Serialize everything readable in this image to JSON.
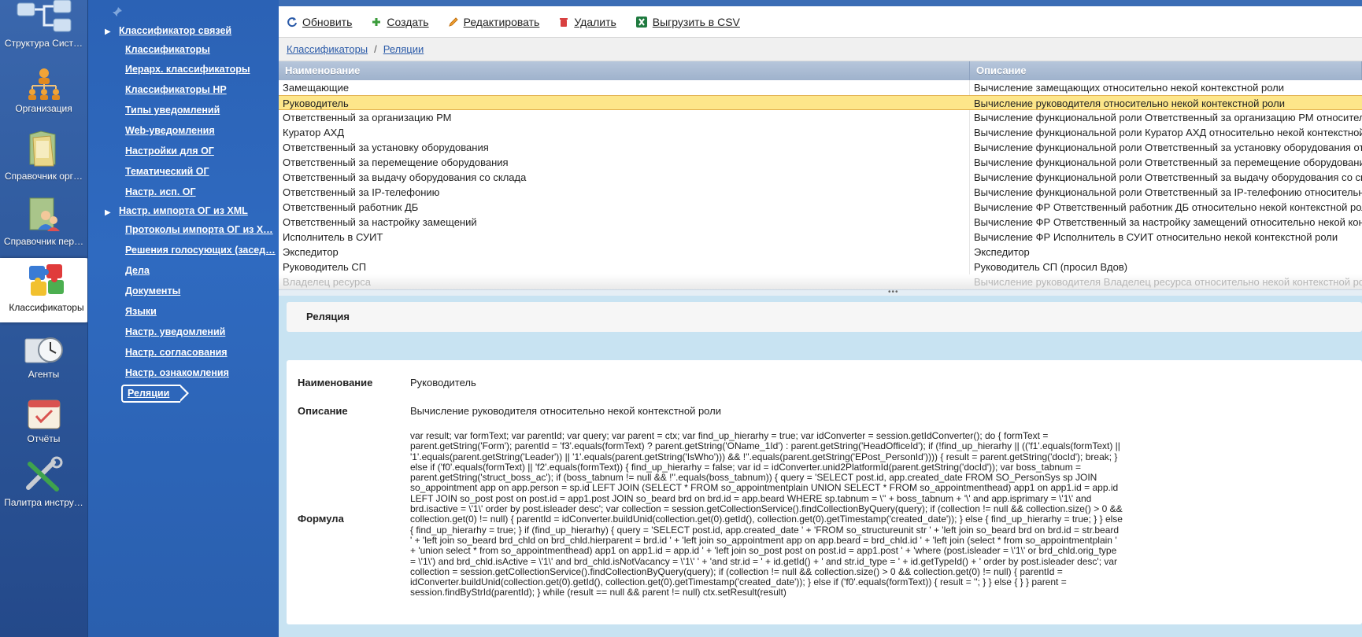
{
  "rail": {
    "items": [
      {
        "label": "Структура Сист…",
        "icon": "structure-icon"
      },
      {
        "label": "Организация",
        "icon": "organization-icon"
      },
      {
        "label": "Справочник орг…",
        "icon": "folder-icon"
      },
      {
        "label": "Справочник пер…",
        "icon": "people-directory-icon"
      },
      {
        "label": "Классификаторы",
        "icon": "puzzle-icon"
      },
      {
        "label": "Агенты",
        "icon": "clock-icon"
      },
      {
        "label": "Отчёты",
        "icon": "calendar-check-icon"
      },
      {
        "label": "Палитра инстру…",
        "icon": "tools-icon"
      }
    ]
  },
  "nav": {
    "items": [
      "Классификатор связей",
      "Классификаторы",
      "Иерарх. классификаторы",
      "Классификаторы НР",
      "Типы уведомлений",
      "Web-уведомления",
      "Настройки для ОГ",
      "Тематический ОГ",
      "Настр. исп. ОГ",
      "Настр. импорта ОГ из XML",
      "Протоколы импорта ОГ из X…",
      "Решения голосующих (засед…",
      "Дела",
      "Документы",
      "Языки",
      "Настр. уведомлений",
      "Настр. согласования",
      "Настр. ознакомления",
      "Реляции"
    ]
  },
  "toolbar": {
    "refresh": "Обновить",
    "create": "Создать",
    "edit": "Редактировать",
    "delete": "Удалить",
    "export": "Выгрузить в CSV"
  },
  "breadcrumb": {
    "parent": "Классификаторы",
    "separator": "/",
    "current": "Реляции"
  },
  "grid": {
    "columns": [
      "Наименование",
      "Описание"
    ],
    "rows": [
      [
        "Замещающие",
        "Вычисление замещающих относительно некой контекстной роли"
      ],
      [
        "Руководитель",
        "Вычисление руководителя относительно некой контекстной роли"
      ],
      [
        "Ответственный за организацию РМ",
        "Вычисление функциональной роли Ответственный за организацию РМ относительно некой контекстной роли"
      ],
      [
        "Куратор АХД",
        "Вычисление функциональной роли Куратор АХД относительно некой контекстной роли"
      ],
      [
        "Ответственный за установку оборудования",
        "Вычисление функциональной роли Ответственный за установку оборудования относительно некой контекстной роли"
      ],
      [
        "Ответственный за перемещение оборудования",
        "Вычисление функциональной роли Ответственный за перемещение оборудования относительно некой контекстной роли"
      ],
      [
        "Ответственный за выдачу оборудования со склада",
        "Вычисление функциональной роли Ответственный за выдачу оборудования со склада относительно некой контекстной роли"
      ],
      [
        "Ответственный за IP-телефонию",
        "Вычисление функциональной роли Ответственный за IP-телефонию относительно некой контекстной роли"
      ],
      [
        "Ответственный работник ДБ",
        "Вычисление ФР Ответственный работник ДБ относительно некой контекстной роли"
      ],
      [
        "Ответственный за настройку замещений",
        "Вычисление ФР Ответственный за настройку замещений относительно некой контекстной роли"
      ],
      [
        "Исполнитель в СУИТ",
        "Вычисление ФР Исполнитель в СУИТ относительно некой контекстной роли"
      ],
      [
        "Экспедитор",
        "Экспедитор"
      ],
      [
        "Руководитель СП",
        "Руководитель СП (просил Вдов)"
      ],
      [
        "Владелец ресурса",
        "Вычисление руководителя Владелец ресурса относительно некой контекстной роли"
      ]
    ],
    "selected_index": 1
  },
  "detail": {
    "title": "Реляция",
    "name_label": "Наименование",
    "name_value": "Руководитель",
    "desc_label": "Описание",
    "desc_value": "Вычисление руководителя относительно некой контекстной роли",
    "formula_label": "Формула",
    "formula_value": "var result; var formText; var parentId; var query; var parent = ctx; var find_up_hierarhy = true; var idConverter = session.getIdConverter(); do { formText = parent.getString('Form'); parentId = 'f3'.equals(formText) ? parent.getString('OName_1Id') : parent.getString('HeadOfficeId'); if (!find_up_hierarhy || (('f1'.equals(formText) || '1'.equals(parent.getString('Leader')) || '1'.equals(parent.getString('IsWho'))) && !''.equals(parent.getString('EPost_PersonId')))) { result = parent.getString('docId'); break; } else if ('f0'.equals(formText) || 'f2'.equals(formText)) { find_up_hierarhy = false; var id = idConverter.unid2PlatformId(parent.getString('docId')); var boss_tabnum = parent.getString('struct_boss_ac'); if (boss_tabnum != null && !''.equals(boss_tabnum)) { query = 'SELECT post.id, app.created_date FROM SO_PersonSys sp JOIN so_appointment app on app.person = sp.id LEFT JOIN (SELECT * FROM so_appointmentplain UNION SELECT * FROM so_appointmenthead) app1 on app1.id = app.id LEFT JOIN so_post post on post.id = app1.post JOIN so_beard brd on brd.id = app.beard WHERE sp.tabnum = \\'' + boss_tabnum + '\\' and app.isprimary = \\'1\\' and brd.isactive = \\'1\\' order by post.isleader desc'; var collection = session.getCollectionService().findCollectionByQuery(query); if (collection != null && collection.size() > 0 && collection.get(0) != null) { parentId = idConverter.buildUnid(collection.get(0).getId(), collection.get(0).getTimestamp('created_date')); } else { find_up_hierarhy = true; } } else { find_up_hierarhy = true; } if (find_up_hierarhy) { query = 'SELECT post.id, app.created_date ' + 'FROM so_structureunit str ' + 'left join so_beard brd on brd.id = str.beard ' + 'left join so_beard brd_chld on brd_chld.hierparent = brd.id ' + 'left join so_appointment app on app.beard = brd_chld.id ' + 'left join (select * from so_appointmentplain ' + 'union select * from so_appointmenthead) app1 on app1.id = app.id ' + 'left join so_post post on post.id = app1.post ' + 'where (post.isleader = \\'1\\' or brd_chld.orig_type = \\'1\\') and brd_chld.isActive = \\'1\\' and brd_chld.isNotVacancy = \\'1\\' ' + 'and str.id = ' + id.getId() + ' and str.id_type = ' + id.getTypeId() + ' order by post.isleader desc'; var collection = session.getCollectionService().findCollectionByQuery(query); if (collection != null && collection.size() > 0 && collection.get(0) != null) { parentId = idConverter.buildUnid(collection.get(0).getId(), collection.get(0).getTimestamp('created_date')); } else if ('f0'.equals(formText)) { result = ''; } } else { } } parent = session.findByStrId(parentId); } while (result == null && parent != null) ctx.setResult(result)"
  }
}
